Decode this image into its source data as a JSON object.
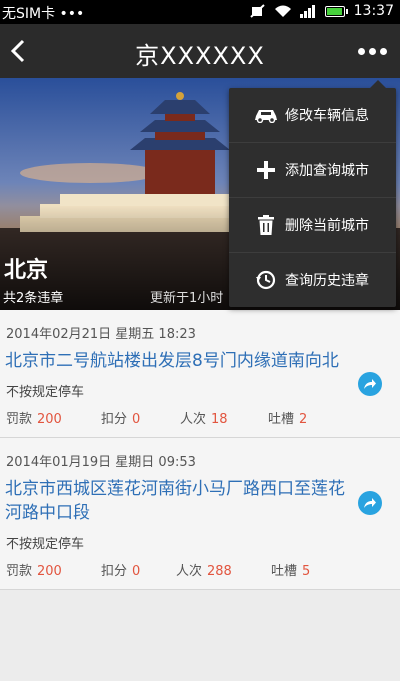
{
  "status_bar": {
    "carrier": "无SIM卡 •••",
    "time": "13:37"
  },
  "nav": {
    "title": "京XXXXXX"
  },
  "hero": {
    "city": "北京",
    "count": "共2条违章",
    "updated": "更新于1小时"
  },
  "menu": {
    "items": [
      {
        "label": "修改车辆信息",
        "icon": "car-icon"
      },
      {
        "label": "添加查询城市",
        "icon": "plus-icon"
      },
      {
        "label": "删除当前城市",
        "icon": "trash-icon"
      },
      {
        "label": "查询历史违章",
        "icon": "history-icon"
      }
    ]
  },
  "records": [
    {
      "date": "2014年02月21日 星期五 18:23",
      "address": "北京市二号航站楼出发层8号门内缘道南向北",
      "reason": "不按规定停车",
      "fine_label": "罚款",
      "fine": "200",
      "points_label": "扣分",
      "points": "0",
      "people_label": "人次",
      "people": "18",
      "comments_label": "吐槽",
      "comments": "2"
    },
    {
      "date": "2014年01月19日 星期日 09:53",
      "address": "北京市西城区莲花河南街小马厂路西口至莲花河路中口段",
      "reason": "不按规定停车",
      "fine_label": "罚款",
      "fine": "200",
      "points_label": "扣分",
      "points": "0",
      "people_label": "人次",
      "people": "288",
      "comments_label": "吐槽",
      "comments": "5"
    }
  ],
  "colors": {
    "accent": "#2e6fb6",
    "value": "#e2553f",
    "share": "#29a3e0"
  }
}
